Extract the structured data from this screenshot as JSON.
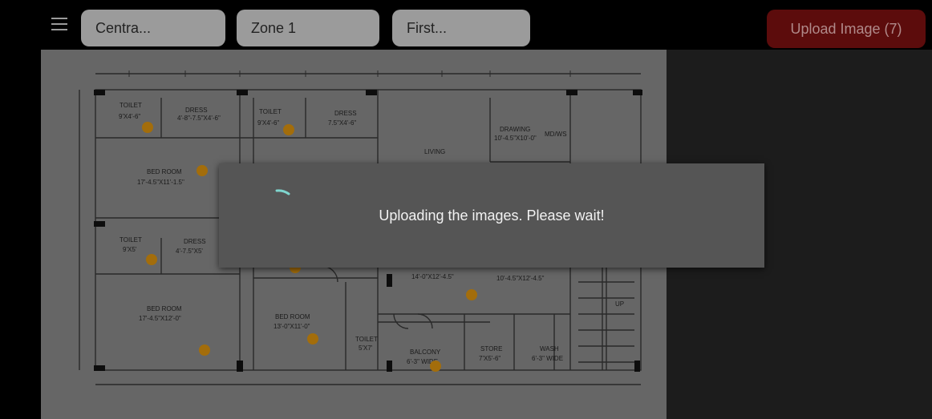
{
  "toolbar": {
    "menu_icon": "hamburger-menu-icon",
    "filters": [
      "Centra...",
      "Zone 1",
      "First..."
    ],
    "upload_label": "Upload Image (7)"
  },
  "dialog": {
    "message": "Uploading the images. Please wait!",
    "spinner_icon": "loading-spinner-icon"
  },
  "colors": {
    "upload_button": "#5c0c0c",
    "marker": "#c7860e",
    "spinner": "#7fd6cf"
  },
  "floor_plan": {
    "room_labels": [
      "TOILET",
      "9'X4'-6\"",
      "DRESS",
      "4'-8\"-7.5\"X4'-6\"",
      "TOILET",
      "9'X4'-6\"",
      "DRESS",
      "7.5\"X4'-6\"",
      "LIVING",
      "DRAWING",
      "10'-4.5\"X10'-0\"",
      "MD/WS",
      "BED ROOM",
      "17'-4.5\"X11'-1.5\"",
      "TOILET",
      "9'X5'",
      "DRESS",
      "4'-7.5\"X5'",
      "14'-0\"X12'-4.5\"",
      "10'-4.5\"X12'-4.5\"",
      "BED ROOM",
      "17'-4.5\"X12'-0\"",
      "BED ROOM",
      "13'-0\"X11'-0\"",
      "TOILET",
      "5'X7'",
      "BALCONY",
      "6'-3\" WIDE",
      "STORE",
      "7'X5'-6\"",
      "WASH",
      "6'-3\" WIDE",
      "UP"
    ]
  }
}
